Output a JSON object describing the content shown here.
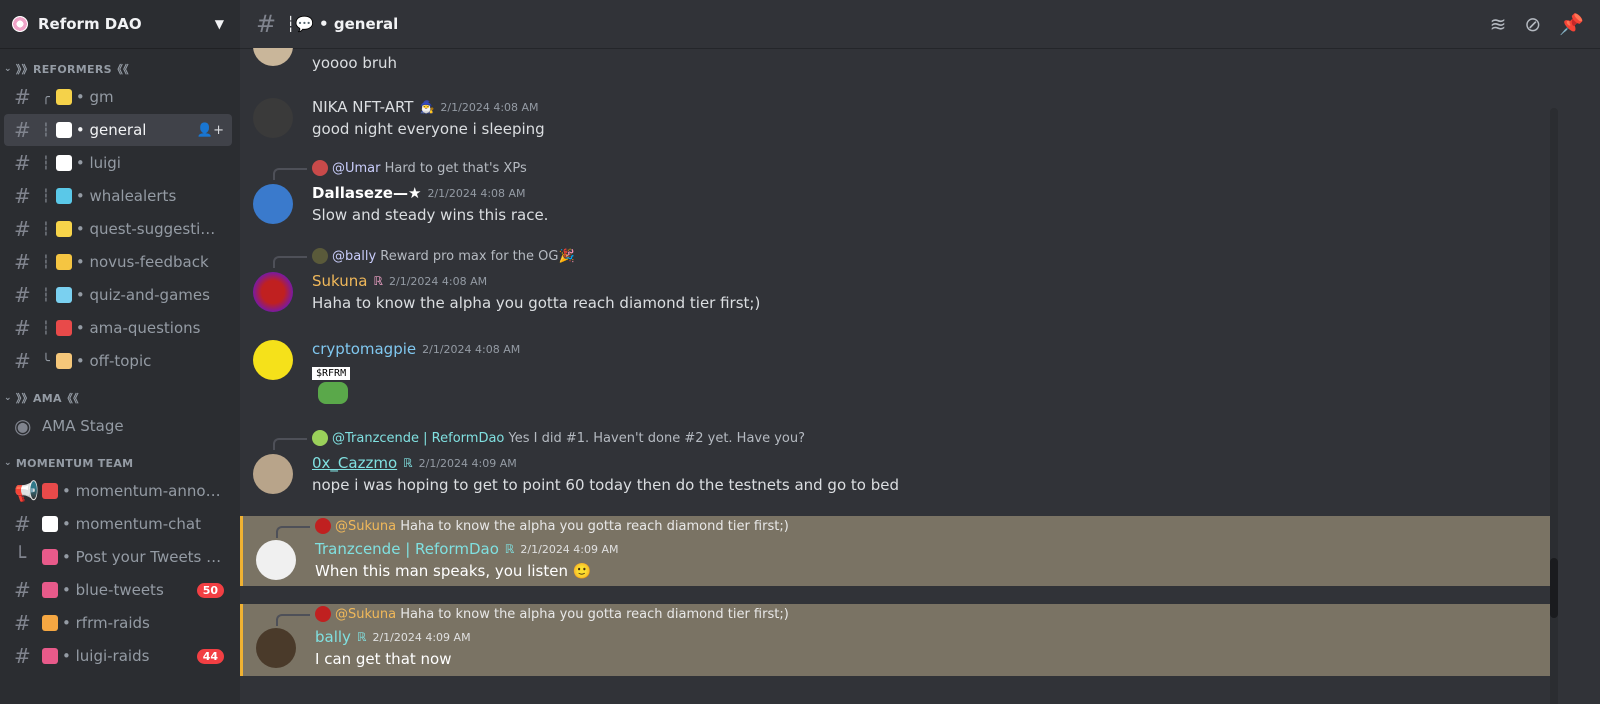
{
  "server": {
    "name": "Reform DAO"
  },
  "categories": {
    "reformers": "》》REFORMERS《《",
    "ama": "》》AMA《《",
    "momentum": "MOMENTUM TEAM"
  },
  "channels": [
    {
      "label": "• gm",
      "prefix": "╭",
      "emoji_color": "#f5d24a"
    },
    {
      "label": "• general",
      "prefix": "┆",
      "emoji_color": "#ffffff"
    },
    {
      "label": "• luigi",
      "prefix": "┆",
      "emoji_color": "#ffffff"
    },
    {
      "label": "• whalealerts",
      "prefix": "┆",
      "emoji_color": "#5ac8e8"
    },
    {
      "label": "• quest-suggestions",
      "prefix": "┆",
      "emoji_color": "#f7d44a"
    },
    {
      "label": "• novus-feedback",
      "prefix": "┆",
      "emoji_color": "#f5c542"
    },
    {
      "label": "• quiz-and-games",
      "prefix": "┆",
      "emoji_color": "#7ad0f0"
    },
    {
      "label": "• ama-questions",
      "prefix": "┆",
      "emoji_color": "#e84a4a"
    },
    {
      "label": "• off-topic",
      "prefix": "╰",
      "emoji_color": "#f5c77a"
    }
  ],
  "ama_stage": "AMA Stage",
  "momentum_channels": [
    {
      "label": "• momentum-annou...",
      "emoji_color": "#e84a4a"
    },
    {
      "label": "• momentum-chat",
      "emoji_color": "#ffffff"
    },
    {
      "label": "• Post your Tweets f...",
      "emoji_color": "#e85a8a"
    },
    {
      "label": "• blue-tweets",
      "emoji_color": "#e85a8a",
      "badge": "50"
    },
    {
      "label": "• rfrm-raids",
      "emoji_color": "#f5a742"
    },
    {
      "label": "• luigi-raids",
      "emoji_color": "#e85a8a",
      "badge": "44"
    }
  ],
  "topbar": {
    "title": "┆💬 • general"
  },
  "messages": [
    {
      "body": "yoooo bruh"
    },
    {
      "user": "NIKA NFT-ART",
      "user_tag": "🧙‍♂️",
      "ts": "2/1/2024 4:08 AM",
      "body": "good night everyone i sleeping",
      "color": "#dbdee1"
    },
    {
      "reply_user": "@Umar",
      "reply_text": "Hard to get that's XPs",
      "user": "Dallaseze—★",
      "ts": "2/1/2024 4:08 AM",
      "body": "Slow and steady wins this race.",
      "color": "#ffffff"
    },
    {
      "reply_user": "@bally",
      "reply_text": "Reward pro max for the OG🎉",
      "user": "Sukuna",
      "ts": "2/1/2024 4:08 AM",
      "body": "Haha to know the alpha you gotta reach diamond tier first;)",
      "color": "#f0b85a"
    },
    {
      "user": "cryptomagpie",
      "ts": "2/1/2024 4:08 AM",
      "sticker": "$RFRM",
      "color": "#80c8f0"
    },
    {
      "reply_user": "@Tranzcende | ReformDao",
      "reply_text": "Yes I did #1. Haven't done #2 yet. Have you?",
      "user": "0x_Cazzmo",
      "ts": "2/1/2024 4:09 AM",
      "body": "nope i was hoping to get to point 60 today then do the testnets and go to bed",
      "color": "#80e0e0"
    },
    {
      "reply_user": "@Sukuna",
      "reply_text": "Haha to know the alpha you gotta reach diamond tier first;)",
      "user": "Tranzcende | ReformDao",
      "ts": "2/1/2024 4:09 AM",
      "body": "When this man speaks, you listen 🙂",
      "color": "#80e0e0"
    },
    {
      "reply_user": "@Sukuna",
      "reply_text": "Haha to know the alpha you gotta reach diamond tier first;)",
      "user": "bally",
      "ts": "2/1/2024 4:09 AM",
      "body": "I can get that now",
      "color": "#80e0e0"
    }
  ]
}
